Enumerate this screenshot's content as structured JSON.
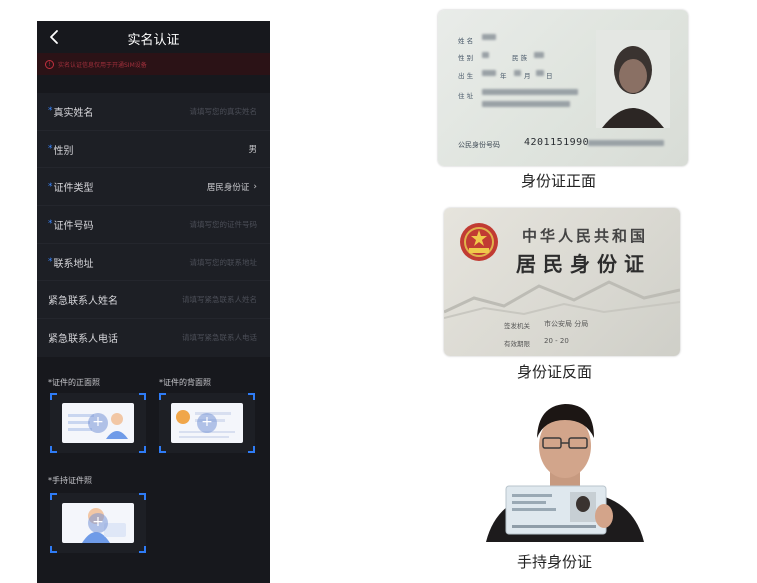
{
  "app": {
    "title": "实名认证",
    "notice": "实名认证信息仅用于开通SIM设备"
  },
  "form": {
    "fields": [
      {
        "label": "真实姓名",
        "required": "*",
        "placeholder": "请填写您的真实姓名"
      },
      {
        "label": "性别",
        "required": "*",
        "value": "男"
      },
      {
        "label": "证件类型",
        "required": "*",
        "value": "居民身份证",
        "chevron": "›"
      },
      {
        "label": "证件号码",
        "required": "*",
        "placeholder": "请填写您的证件号码"
      },
      {
        "label": "联系地址",
        "required": "*",
        "placeholder": "请填写您的联系地址"
      },
      {
        "label": "紧急联系人姓名",
        "placeholder": "请填写紧急联系人姓名"
      },
      {
        "label": "紧急联系人电话",
        "placeholder": "请填写紧急联系人电话"
      }
    ]
  },
  "uploads": [
    {
      "label": "*证件的正面照",
      "plus": "+"
    },
    {
      "label": "*证件的背面照",
      "plus": "+"
    },
    {
      "label": "*手持证件照",
      "plus": "+"
    }
  ],
  "samples": {
    "front_caption": "身份证正面",
    "back_caption": "身份证反面",
    "hand_caption": "手持身份证",
    "front": {
      "name_label": "姓 名",
      "gender_label": "性 别",
      "ethnicity_label": "民 族",
      "birth_label": "出 生",
      "birth_year": "年",
      "birth_month": "月",
      "birth_day": "日",
      "address_label": "住 址",
      "id_title": "公民身份号码",
      "id_number": "4201151990"
    },
    "back": {
      "country": "中华人民共和国",
      "card_type": "居民身份证",
      "authority_label": "签发机关",
      "authority_value": "市公安局 分局",
      "validity_label": "有效期限",
      "validity_value": "20 - 20"
    }
  },
  "colors": {
    "panel_bg": "#17181d",
    "form_bg": "#1d1f25",
    "accent": "#2f7cf6",
    "warning": "#c0303e"
  },
  "icons": {
    "back": "chevron-left-icon",
    "warning": "warning-icon",
    "plus": "plus-icon"
  }
}
